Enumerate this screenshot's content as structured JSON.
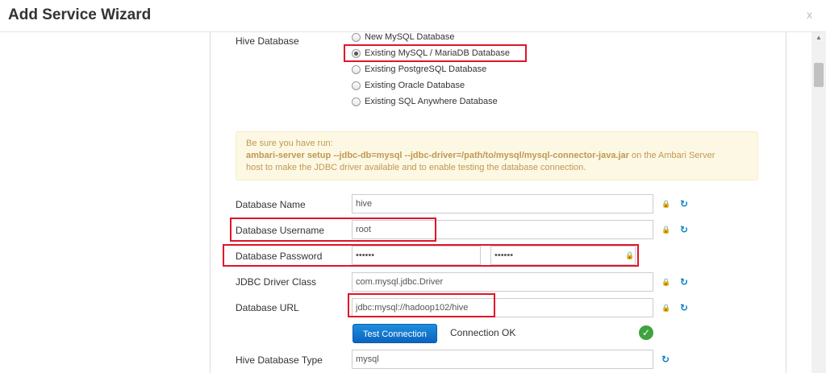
{
  "header": {
    "title": "Add Service Wizard",
    "close_label": "x"
  },
  "hive_db": {
    "label": "Hive Database",
    "options": [
      "New MySQL Database",
      "Existing MySQL / MariaDB Database",
      "Existing PostgreSQL Database",
      "Existing Oracle Database",
      "Existing SQL Anywhere Database"
    ],
    "selected_index": 1
  },
  "alert": {
    "line1": "Be sure you have run:",
    "command": "ambari-server setup --jdbc-db=mysql --jdbc-driver=/path/to/mysql/mysql-connector-java.jar",
    "after_command": " on the Ambari Server",
    "line3": "host to make the JDBC driver available and to enable testing the database connection."
  },
  "fields": {
    "db_name": {
      "label": "Database Name",
      "value": "hive"
    },
    "db_user": {
      "label": "Database Username",
      "value": "root"
    },
    "db_pass": {
      "label": "Database Password",
      "value": "••••••",
      "confirm": "••••••"
    },
    "jdbc_class": {
      "label": "JDBC Driver Class",
      "value": "com.mysql.jdbc.Driver"
    },
    "db_url": {
      "label": "Database URL",
      "value": "jdbc:mysql://hadoop102/hive"
    },
    "db_type": {
      "label": "Hive Database Type",
      "value": "mysql"
    }
  },
  "test": {
    "button_label": "Test Connection",
    "status": "Connection OK"
  },
  "icons": {
    "lock": "lock-icon",
    "refresh": "refresh-icon",
    "check": "check-circle-icon"
  },
  "colors": {
    "accent": "#0a7fc2",
    "highlight": "#e0142a",
    "success": "#3fa33f",
    "warning_bg": "#fcf8e3"
  }
}
